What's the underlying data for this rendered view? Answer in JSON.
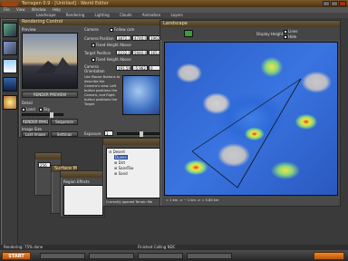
{
  "app": {
    "title": "Terragen 0.9 - [Untitled] - World Editor",
    "menu": [
      "File",
      "View",
      "Window",
      "Help"
    ],
    "tabs": [
      "Landscape",
      "Rendering",
      "Lighting",
      "Clouds",
      "Animation",
      "Layers"
    ]
  },
  "rendering": {
    "title": "Rendering Control",
    "preview_label": "Preview",
    "render_preview_btn": "RENDER PREVIEW",
    "detail_label": "Detail",
    "land_label": "Land",
    "sky_label": "Sky",
    "render_image_btn": "RENDER IMAGE",
    "sequence_btn": "Sequence",
    "image_size_label": "Image Size",
    "last_image_btn": "Last Image",
    "settings_btn": "Settings",
    "camera_label": "Camera",
    "follow_cam_label": "Follow cam",
    "camera_position_label": "Camera Position",
    "camera_position": [
      "3872.25",
      "4740.00",
      "1962.3"
    ],
    "fixed_height_above_label": "Fixed Height Above",
    "target_position_label": "Target Position",
    "target_position": [
      "2232.0",
      "5940.0",
      "165.0"
    ],
    "fixed_height_above_2_label": "Fixed Height Above",
    "camera_orientation_label": "Camera Orientation",
    "camera_orientation": [
      "191.598",
      "-5.962",
      "0"
    ],
    "hint": "Use Mouse Buttons to describe the Camera's view. Left button positions the Camera, and Right button positions the Target",
    "exposure_label": "Exposure",
    "exposure_value": "1"
  },
  "small_panels": {
    "size_value": "256",
    "surface_map_label": "Surface Map",
    "region_effects_label": "Region Effects"
  },
  "surface_tree": {
    "items": [
      "Desert",
      "Dunes",
      "Dirt",
      "SandToo",
      "Sand"
    ],
    "status": "Currently opened Terrain file"
  },
  "landscape": {
    "title": "Landscape",
    "display_height_label": "Display Height",
    "option_lines": "Lines",
    "option_hide": "Hide",
    "scale_text": "= 1 km  ->  ~ 1 km  ->  = 5.80 km"
  },
  "taskbar": {
    "start_label": "START",
    "status_left": "Rendering: 75% done",
    "status_mid": "Finished Calling NDC"
  },
  "colors": {
    "accent": "#e07a1a",
    "background": "#3a3a3a",
    "panel": "#4a4a4a"
  }
}
